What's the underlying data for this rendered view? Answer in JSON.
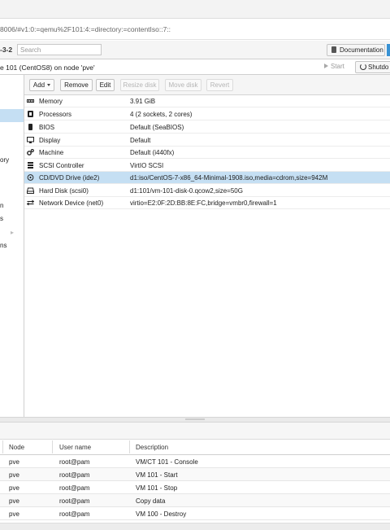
{
  "browser": {
    "url": "8006/#v1:0:=qemu%2F101:4:=directory:=contentIso::7::"
  },
  "header": {
    "version": "-3-2",
    "search_placeholder": "Search",
    "documentation_label": "Documentation"
  },
  "title_bar": {
    "title": "e 101 (CentOS8) on node 'pve'",
    "start_label": "Start",
    "shutdown_label": "Shutdo"
  },
  "left_menu": {
    "fragments": [
      "ory",
      "n",
      "s",
      "ns"
    ]
  },
  "toolbar": {
    "add_label": "Add",
    "remove_label": "Remove",
    "edit_label": "Edit",
    "resize_label": "Resize disk",
    "move_label": "Move disk",
    "revert_label": "Revert"
  },
  "hardware": [
    {
      "icon": "memory-icon",
      "name": "Memory",
      "value": "3.91 GiB"
    },
    {
      "icon": "processor-icon",
      "name": "Processors",
      "value": "4 (2 sockets, 2 cores)"
    },
    {
      "icon": "bios-icon",
      "name": "BIOS",
      "value": "Default (SeaBIOS)"
    },
    {
      "icon": "display-icon",
      "name": "Display",
      "value": "Default"
    },
    {
      "icon": "machine-icon",
      "name": "Machine",
      "value": "Default (i440fx)"
    },
    {
      "icon": "scsi-controller-icon",
      "name": "SCSI Controller",
      "value": "VirtIO SCSI"
    },
    {
      "icon": "cdrom-icon",
      "name": "CD/DVD Drive (ide2)",
      "value": "d1:iso/CentOS-7-x86_64-Minimal-1908.iso,media=cdrom,size=942M",
      "selected": true
    },
    {
      "icon": "harddisk-icon",
      "name": "Hard Disk (scsi0)",
      "value": "d1:101/vm-101-disk-0.qcow2,size=50G"
    },
    {
      "icon": "network-icon",
      "name": "Network Device (net0)",
      "value": "virtio=E2:0F:2D:BB:8E:FC,bridge=vmbr0,firewall=1"
    }
  ],
  "tasks": {
    "columns": [
      "Node",
      "User name",
      "Description"
    ],
    "rows": [
      {
        "node": "pve",
        "user": "root@pam",
        "description": "VM/CT 101 - Console"
      },
      {
        "node": "pve",
        "user": "root@pam",
        "description": "VM 101 - Start"
      },
      {
        "node": "pve",
        "user": "root@pam",
        "description": "VM 101 - Stop"
      },
      {
        "node": "pve",
        "user": "root@pam",
        "description": "Copy data"
      },
      {
        "node": "pve",
        "user": "root@pam",
        "description": "VM 100 - Destroy"
      }
    ]
  },
  "colors": {
    "selection": "#c5dff3",
    "accent": "#3892d4"
  }
}
